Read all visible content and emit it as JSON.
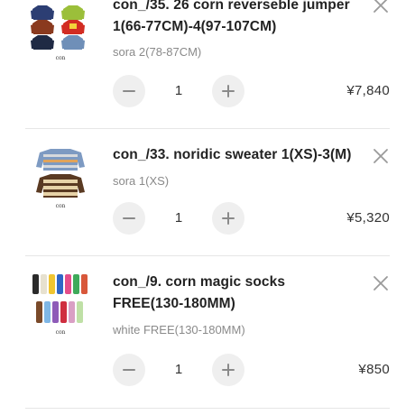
{
  "cart": {
    "items": [
      {
        "title": "con_/35. 26 corn reverseble jumper 1(66-77CM)-4(97-107CM)",
        "variant": "sora 2(78-87CM)",
        "quantity": "1",
        "price": "¥7,840",
        "thumb_brand": "con",
        "thumb_icon": "jumper-product-image"
      },
      {
        "title": "con_/33. noridic sweater 1(XS)-3(M)",
        "variant": "sora 1(XS)",
        "quantity": "1",
        "price": "¥5,320",
        "thumb_brand": "con",
        "thumb_icon": "sweater-product-image"
      },
      {
        "title": "con_/9. corn magic socks FREE(130-180MM)",
        "variant": "white FREE(130-180MM)",
        "quantity": "1",
        "price": "¥850",
        "thumb_brand": "con",
        "thumb_icon": "socks-product-image"
      }
    ],
    "controls": {
      "decrease_icon": "minus-icon",
      "increase_icon": "plus-icon",
      "remove_icon": "close-icon"
    },
    "colors": {
      "text": "#222222",
      "muted": "#8a8a8a",
      "button_bg": "#efefef",
      "divider": "#e6e6e6"
    }
  }
}
